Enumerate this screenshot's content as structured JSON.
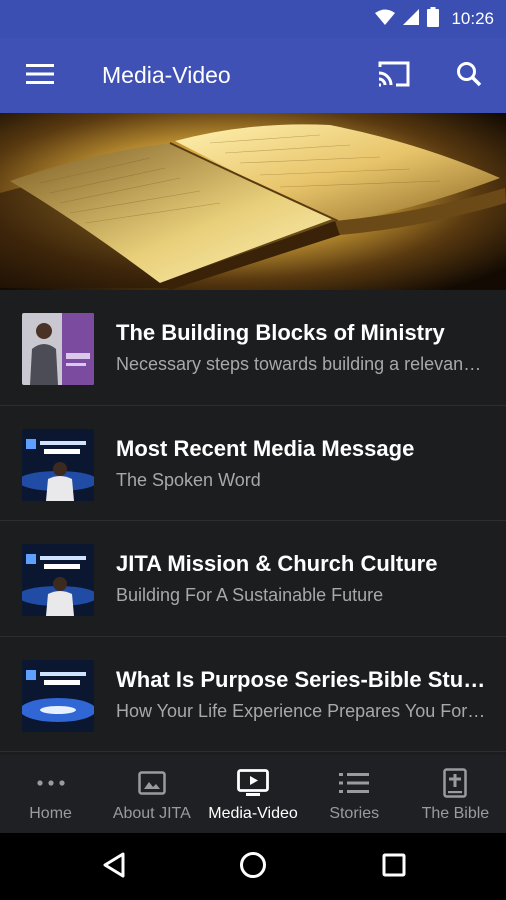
{
  "status_bar": {
    "time": "10:26",
    "icons": [
      "wifi-icon",
      "signal-icon",
      "battery-icon"
    ]
  },
  "app_bar": {
    "title": "Media-Video",
    "icons": [
      "menu-icon",
      "cast-icon",
      "search-icon"
    ],
    "color": "#3f51b5"
  },
  "list": {
    "items": [
      {
        "title": "The Building Blocks of Ministry",
        "subtitle": "Necessary steps towards building a relevant ministry"
      },
      {
        "title": "Most Recent Media Message",
        "subtitle": "The Spoken Word"
      },
      {
        "title": "JITA Mission & Church Culture",
        "subtitle": "Building For A Sustainable Future"
      },
      {
        "title": "What Is Purpose Series-Bible Study",
        "subtitle": "How Your Life Experience Prepares You For Purpose"
      }
    ]
  },
  "bottom_nav": {
    "items": [
      {
        "label": "Home",
        "icon": "more-dots-icon",
        "active": false
      },
      {
        "label": "About JITA",
        "icon": "image-icon",
        "active": false
      },
      {
        "label": "Media-Video",
        "icon": "tv-play-icon",
        "active": true
      },
      {
        "label": "Stories",
        "icon": "list-icon",
        "active": false
      },
      {
        "label": "The Bible",
        "icon": "bible-icon",
        "active": false
      }
    ]
  },
  "system_nav": {
    "icons": [
      "back-icon",
      "home-icon",
      "recents-icon"
    ]
  }
}
